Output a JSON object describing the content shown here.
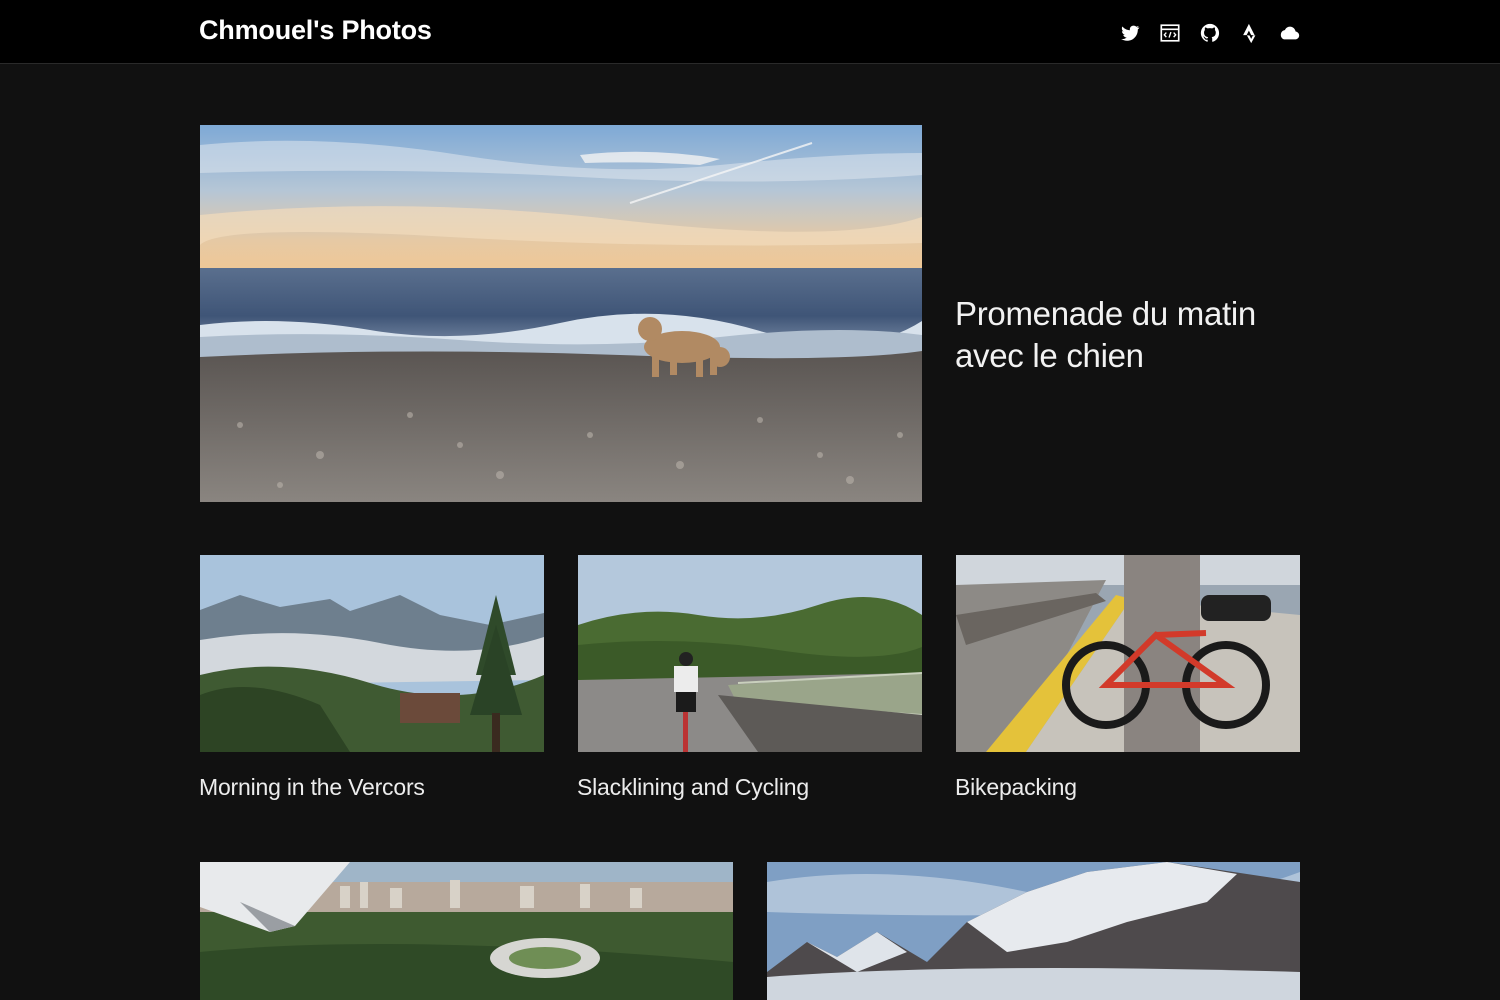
{
  "header": {
    "site_title": "Chmouel's Photos",
    "social": [
      {
        "icon": "twitter-icon"
      },
      {
        "icon": "blog-code-icon"
      },
      {
        "icon": "github-icon"
      },
      {
        "icon": "strava-icon"
      },
      {
        "icon": "cloud-icon"
      }
    ]
  },
  "featured": {
    "title": "Promenade du matin avec le chien"
  },
  "posts": [
    {
      "caption": "Morning in the Vercors"
    },
    {
      "caption": "Slacklining and Cycling"
    },
    {
      "caption": "Bikepacking"
    }
  ],
  "colors": {
    "background": "#111111",
    "header_background": "#000000",
    "text": "#eeeeee"
  }
}
